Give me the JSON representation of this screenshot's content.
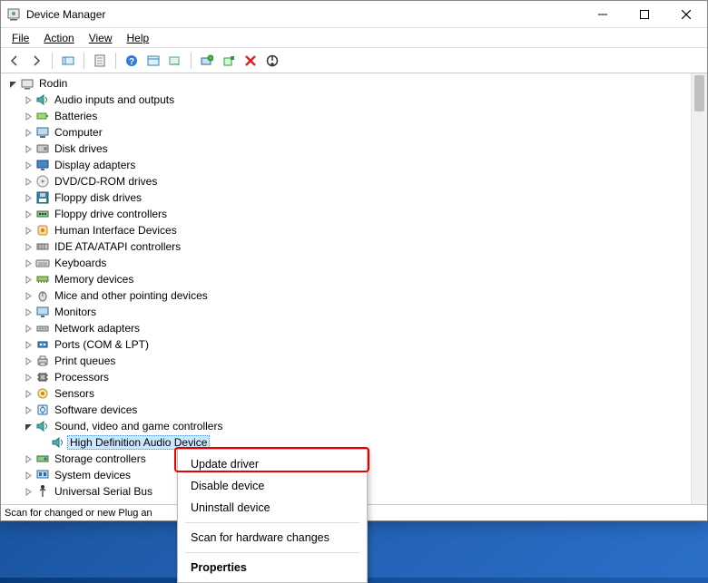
{
  "window": {
    "title": "Device Manager"
  },
  "menubar": {
    "file": "File",
    "action": "Action",
    "view": "View",
    "help": "Help"
  },
  "toolbar": {
    "back": "back",
    "forward": "forward",
    "show_hidden": "show-hidden",
    "properties": "properties",
    "help": "help",
    "details_toggle": "details",
    "scan": "scan",
    "monitor": "monitor",
    "add": "add",
    "remove": "remove",
    "update": "update"
  },
  "tree": {
    "root": "Rodin",
    "categories": [
      {
        "label": "Audio inputs and outputs",
        "icon": "speaker"
      },
      {
        "label": "Batteries",
        "icon": "battery"
      },
      {
        "label": "Computer",
        "icon": "computer"
      },
      {
        "label": "Disk drives",
        "icon": "disk"
      },
      {
        "label": "Display adapters",
        "icon": "display"
      },
      {
        "label": "DVD/CD-ROM drives",
        "icon": "cd"
      },
      {
        "label": "Floppy disk drives",
        "icon": "floppy"
      },
      {
        "label": "Floppy drive controllers",
        "icon": "controller"
      },
      {
        "label": "Human Interface Devices",
        "icon": "hid"
      },
      {
        "label": "IDE ATA/ATAPI controllers",
        "icon": "ide"
      },
      {
        "label": "Keyboards",
        "icon": "keyboard"
      },
      {
        "label": "Memory devices",
        "icon": "memory"
      },
      {
        "label": "Mice and other pointing devices",
        "icon": "mouse"
      },
      {
        "label": "Monitors",
        "icon": "monitor"
      },
      {
        "label": "Network adapters",
        "icon": "network"
      },
      {
        "label": "Ports (COM & LPT)",
        "icon": "port"
      },
      {
        "label": "Print queues",
        "icon": "printer"
      },
      {
        "label": "Processors",
        "icon": "cpu"
      },
      {
        "label": "Sensors",
        "icon": "sensor"
      },
      {
        "label": "Software devices",
        "icon": "software"
      },
      {
        "label": "Sound, video and game controllers",
        "icon": "speaker",
        "expanded": true,
        "children": [
          {
            "label": "High Definition Audio Device",
            "icon": "speaker",
            "selected": true
          }
        ]
      },
      {
        "label": "Storage controllers",
        "icon": "storage"
      },
      {
        "label": "System devices",
        "icon": "system"
      },
      {
        "label": "Universal Serial Bus controllers",
        "icon": "usb",
        "cut": true
      }
    ]
  },
  "contextmenu": {
    "update": "Update driver",
    "disable": "Disable device",
    "uninstall": "Uninstall device",
    "scan": "Scan for hardware changes",
    "properties": "Properties"
  },
  "statusbar": {
    "text": "Scan for changed or new Plug an"
  }
}
